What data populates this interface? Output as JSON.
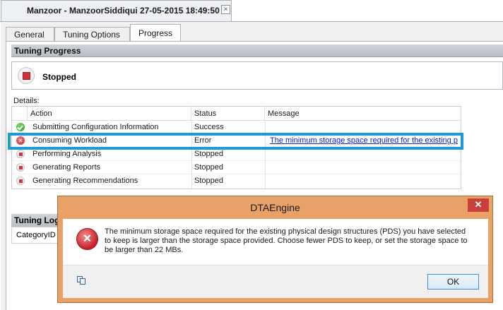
{
  "session": {
    "title": "Manzoor - ManzoorSiddiqui 27-05-2015 18:49:50",
    "close_glyph": "×"
  },
  "tabs": [
    {
      "label": "General"
    },
    {
      "label": "Tuning Options"
    },
    {
      "label": "Progress",
      "active": true
    }
  ],
  "progress": {
    "section_title": "Tuning Progress",
    "state": "Stopped",
    "details_label": "Details:"
  },
  "grid": {
    "columns": [
      "Action",
      "Status",
      "Message"
    ],
    "rows": [
      {
        "icon": "success-check-icon",
        "action": "Submitting Configuration Information",
        "status": "Success",
        "message": ""
      },
      {
        "icon": "error-x-icon",
        "action": "Consuming Workload",
        "status": "Error",
        "message": "The minimum storage space required for the existing p..."
      },
      {
        "icon": "stopped-icon",
        "action": "Performing Analysis",
        "status": "Stopped",
        "message": ""
      },
      {
        "icon": "stopped-icon",
        "action": "Generating Reports",
        "status": "Stopped",
        "message": ""
      },
      {
        "icon": "stopped-icon",
        "action": "Generating Recommendations",
        "status": "Stopped",
        "message": ""
      }
    ]
  },
  "tuning_log": {
    "section_title": "Tuning Log",
    "column": "CategoryID"
  },
  "dialog": {
    "title": "DTAEngine",
    "close_glyph": "✕",
    "message": "The minimum storage space required for the existing physical design structures (PDS) you have selected to keep is larger than the storage space provided. Choose fewer PDS to keep, or set the storage space to be larger than 22 MBs.",
    "ok_label": "OK"
  },
  "colors": {
    "highlight": "#1c9bd6",
    "dialog_frame": "#e8a268",
    "dialog_close": "#c7413a",
    "link": "#0b22c8"
  }
}
